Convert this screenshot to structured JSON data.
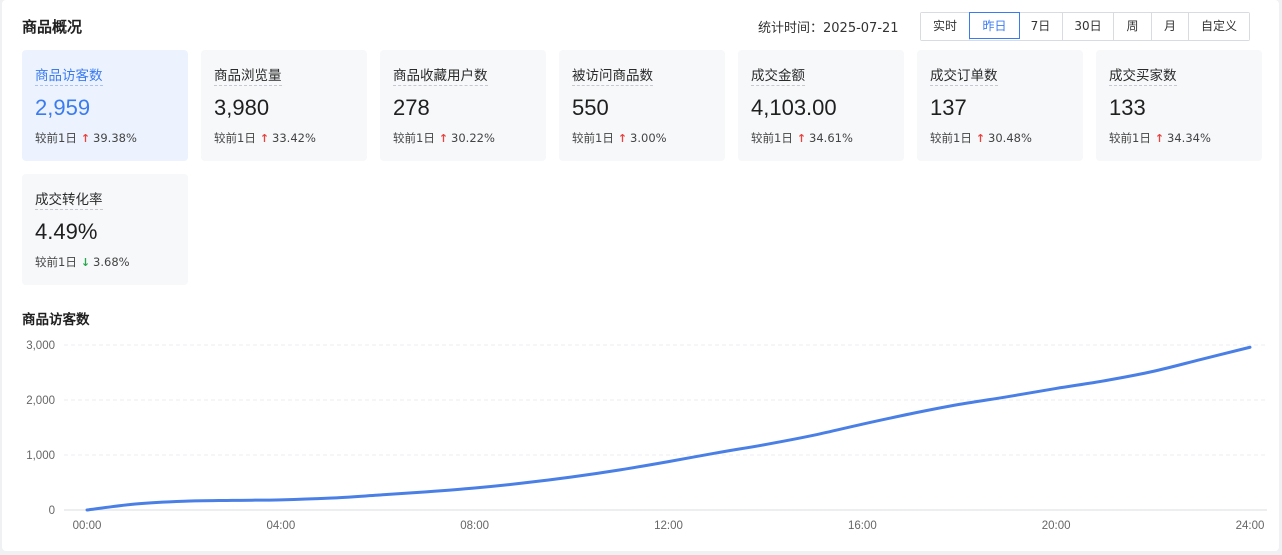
{
  "header": {
    "title": "商品概况",
    "stat_time_label": "统计时间：2025-07-21"
  },
  "range_buttons": [
    {
      "label": "实时",
      "active": false
    },
    {
      "label": "昨日",
      "active": true
    },
    {
      "label": "7日",
      "active": false
    },
    {
      "label": "30日",
      "active": false
    },
    {
      "label": "周",
      "active": false
    },
    {
      "label": "月",
      "active": false
    },
    {
      "label": "自定义",
      "active": false
    }
  ],
  "cards": [
    {
      "label": "商品访客数",
      "value": "2,959",
      "compare_label": "较前1日",
      "trend": "up",
      "change": "39.38%",
      "active": true
    },
    {
      "label": "商品浏览量",
      "value": "3,980",
      "compare_label": "较前1日",
      "trend": "up",
      "change": "33.42%",
      "active": false
    },
    {
      "label": "商品收藏用户数",
      "value": "278",
      "compare_label": "较前1日",
      "trend": "up",
      "change": "30.22%",
      "active": false
    },
    {
      "label": "被访问商品数",
      "value": "550",
      "compare_label": "较前1日",
      "trend": "up",
      "change": "3.00%",
      "active": false
    },
    {
      "label": "成交金额",
      "value": "4,103.00",
      "compare_label": "较前1日",
      "trend": "up",
      "change": "34.61%",
      "active": false
    },
    {
      "label": "成交订单数",
      "value": "137",
      "compare_label": "较前1日",
      "trend": "up",
      "change": "30.48%",
      "active": false
    },
    {
      "label": "成交买家数",
      "value": "133",
      "compare_label": "较前1日",
      "trend": "up",
      "change": "34.34%",
      "active": false
    },
    {
      "label": "成交转化率",
      "value": "4.49%",
      "compare_label": "较前1日",
      "trend": "down",
      "change": "3.68%",
      "active": false
    }
  ],
  "colors": {
    "accent": "#3b7bf0",
    "up": "#e8433f",
    "down": "#27a84a",
    "line": "#4a7fe6"
  },
  "chart_data": {
    "type": "line",
    "title": "商品访客数",
    "x_tick_labels": [
      "00:00",
      "04:00",
      "08:00",
      "12:00",
      "16:00",
      "20:00",
      "24:00"
    ],
    "y_tick_labels": [
      "0",
      "1,000",
      "2,000",
      "3,000"
    ],
    "ylim": [
      0,
      3000
    ],
    "xlim": [
      0,
      24
    ],
    "grid": true,
    "series": [
      {
        "x": [
          0,
          1,
          2,
          3,
          4,
          5,
          6,
          7,
          8,
          9,
          10,
          11,
          12,
          13,
          14,
          15,
          16,
          17,
          18,
          19,
          20,
          21,
          22,
          23,
          24
        ],
        "values": [
          0,
          110,
          160,
          175,
          185,
          215,
          270,
          330,
          400,
          490,
          600,
          730,
          880,
          1040,
          1190,
          1360,
          1560,
          1750,
          1920,
          2060,
          2210,
          2350,
          2520,
          2740,
          2959
        ]
      }
    ]
  }
}
